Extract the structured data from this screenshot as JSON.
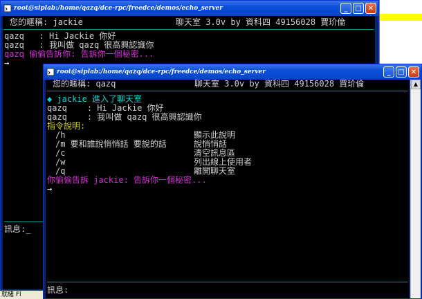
{
  "back_window": {
    "title": "root@siplab:/home/qazq/dce-rpc/freedce/demos/echo_server",
    "nickname_label": "您的暱稱:",
    "nickname": "jackie",
    "app_title": "聊天室 3.0v by 資科四 49156028 賈玠倫",
    "messages": [
      {
        "speaker": "qazq",
        "sep": ": ",
        "text": "Hi Jackie 你好"
      },
      {
        "speaker": "qazq",
        "sep": ": ",
        "text": "我叫做 qazq 很高興認識你"
      },
      {
        "speaker": "qazq",
        "sep": " ",
        "text": "偷偷告訴你: 告訴你一個秘密..."
      }
    ],
    "prompt_arrow": "→",
    "input_label": "訊息:",
    "input_value": "_"
  },
  "front_window": {
    "title": "root@siplab:/home/qazq/dce-rpc/freedce/demos/echo_server",
    "nickname_label": "您的暱稱:",
    "nickname": "qazq",
    "app_title": "聊天室 3.0v by 資科四 49156028 賈玠倫",
    "join_msg": "◆ jackie 進入了聊天室",
    "messages": [
      {
        "speaker": "qazq",
        "sep": ": ",
        "text": "Hi Jackie 你好"
      },
      {
        "speaker": "qazq",
        "sep": ": ",
        "text": "我叫做 qazq 很高興認識你"
      }
    ],
    "help_header": "指令說明:",
    "commands": [
      {
        "cmd": "/h",
        "desc": "顯示此說明"
      },
      {
        "cmd": "/m 要和誰說悄悄話 要說的話",
        "desc": "說悄悄話"
      },
      {
        "cmd": "/c",
        "desc": "清空訊息區"
      },
      {
        "cmd": "/w",
        "desc": "列出線上使用者"
      },
      {
        "cmd": "/q",
        "desc": "離開聊天室"
      }
    ],
    "whisper": "你偷偷告訴 jackie: 告訴你一個秘密...",
    "prompt_arrow": "→",
    "input_label": "訊息:",
    "input_value": ""
  },
  "status_bar_text": "就緒 Fl"
}
